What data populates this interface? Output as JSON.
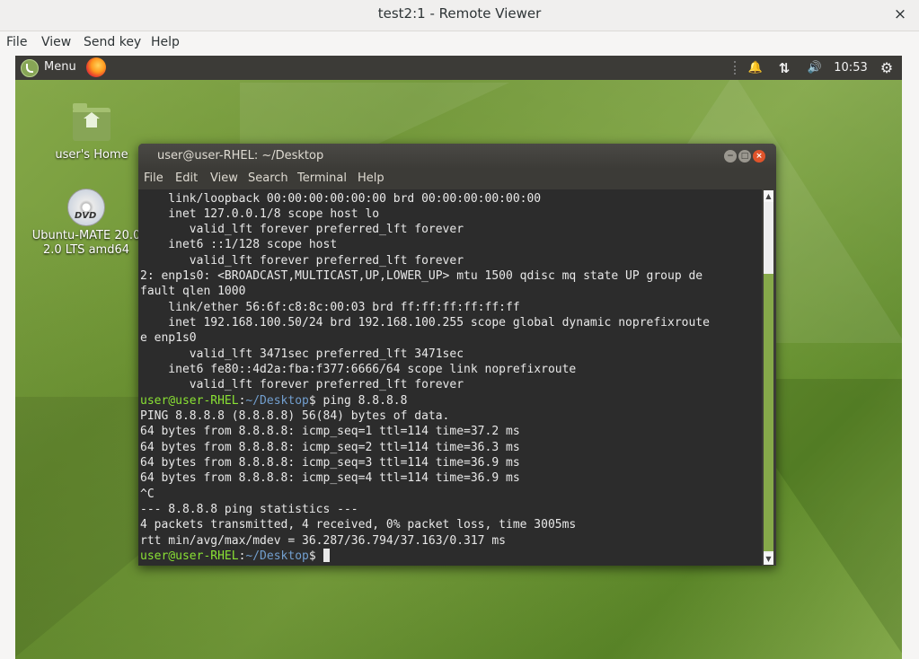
{
  "viewer": {
    "title": "test2:1 - Remote Viewer",
    "close_icon": "×",
    "menu": [
      "File",
      "View",
      "Send key",
      "Help"
    ]
  },
  "panel": {
    "menu_label": "Menu",
    "clock": "10:53",
    "icons": [
      "mate-logo-icon",
      "firefox-icon",
      "bell-icon",
      "network-arrows-icon",
      "volume-icon",
      "settings-gear-icon"
    ],
    "bell_glyph": "🔔",
    "network_glyph": "⇅",
    "volume_glyph": "🔊",
    "gear_glyph": "⚙"
  },
  "desktop": {
    "home_label": "user's Home",
    "dvd_label_line1": "Ubuntu-MATE 20.0",
    "dvd_label_line2": "2.0 LTS amd64",
    "dvd_text": "DVD"
  },
  "terminal": {
    "title": "user@user-RHEL: ~/Desktop",
    "menu": [
      "File",
      "Edit",
      "View",
      "Search",
      "Terminal",
      "Help"
    ],
    "window_buttons": [
      "−",
      "□",
      "×"
    ],
    "lines": [
      "    link/loopback 00:00:00:00:00:00 brd 00:00:00:00:00:00",
      "    inet 127.0.0.1/8 scope host lo",
      "       valid_lft forever preferred_lft forever",
      "    inet6 ::1/128 scope host",
      "       valid_lft forever preferred_lft forever",
      "2: enp1s0: <BROADCAST,MULTICAST,UP,LOWER_UP> mtu 1500 qdisc mq state UP group de",
      "fault qlen 1000",
      "    link/ether 56:6f:c8:8c:00:03 brd ff:ff:ff:ff:ff:ff",
      "    inet 192.168.100.50/24 brd 192.168.100.255 scope global dynamic noprefixroute",
      "e enp1s0",
      "       valid_lft 3471sec preferred_lft 3471sec",
      "    inet6 fe80::4d2a:fba:f377:6666/64 scope link noprefixroute",
      "       valid_lft forever preferred_lft forever"
    ],
    "prompt_user": "user@user-RHEL",
    "prompt_sep": ":",
    "prompt_path": "~/Desktop",
    "prompt_dollar": "$ ",
    "command": "ping 8.8.8.8",
    "output": [
      "PING 8.8.8.8 (8.8.8.8) 56(84) bytes of data.",
      "64 bytes from 8.8.8.8: icmp_seq=1 ttl=114 time=37.2 ms",
      "64 bytes from 8.8.8.8: icmp_seq=2 ttl=114 time=36.3 ms",
      "64 bytes from 8.8.8.8: icmp_seq=3 ttl=114 time=36.9 ms",
      "64 bytes from 8.8.8.8: icmp_seq=4 ttl=114 time=36.9 ms",
      "^C",
      "--- 8.8.8.8 ping statistics ---",
      "4 packets transmitted, 4 received, 0% packet loss, time 3005ms",
      "rtt min/avg/max/mdev = 36.287/36.794/37.163/0.317 ms"
    ]
  },
  "colors": {
    "prompt_user": "#8ae234",
    "prompt_path": "#729fcf",
    "scrollbar_thumb": "#86a94a",
    "panel_bg": "#3c3b37"
  }
}
